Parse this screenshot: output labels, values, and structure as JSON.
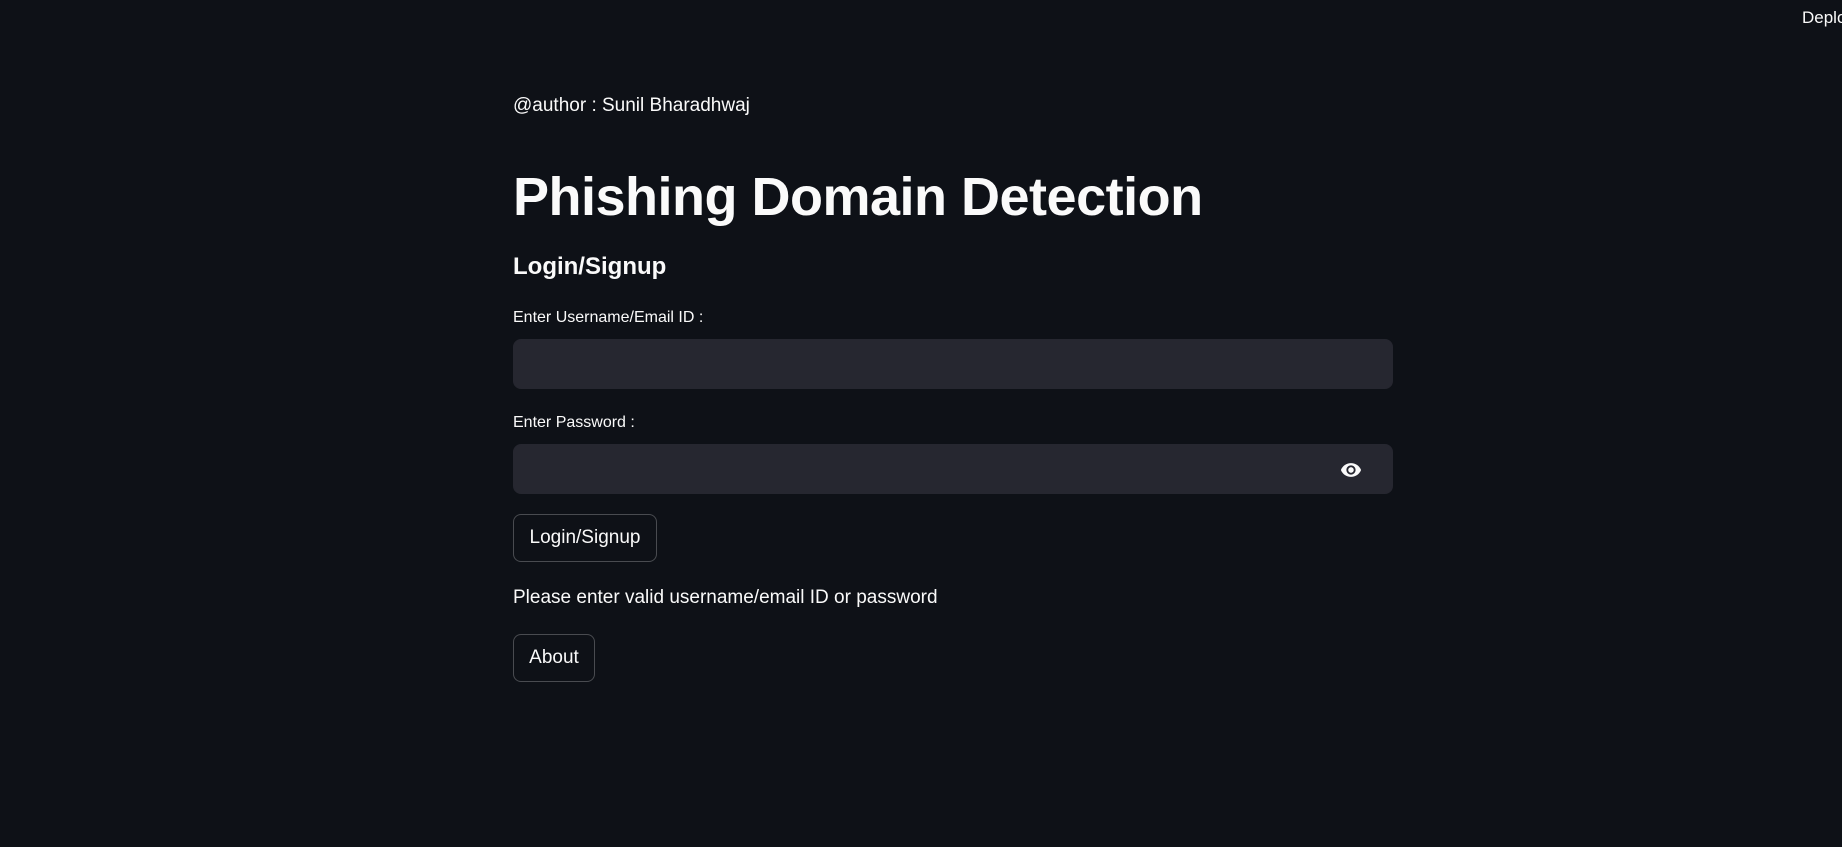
{
  "header": {
    "deploy_label": "Deplo"
  },
  "main": {
    "author": "@author : Sunil Bharadhwaj",
    "title": "Phishing Domain Detection",
    "subtitle": "Login/Signup",
    "username": {
      "label": "Enter Username/Email ID :",
      "value": "",
      "placeholder": ""
    },
    "password": {
      "label": "Enter Password :",
      "value": "",
      "placeholder": "",
      "toggle_icon": "eye-icon"
    },
    "login_button_label": "Login/Signup",
    "message": "Please enter valid username/email ID or password",
    "about_button_label": "About"
  },
  "colors": {
    "background": "#0e1117",
    "input_background": "#262730",
    "text": "#fafafa"
  }
}
